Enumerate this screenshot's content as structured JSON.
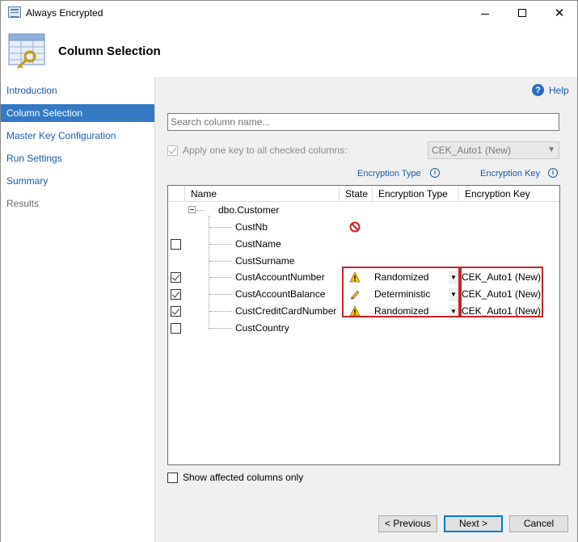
{
  "window": {
    "title": "Always Encrypted",
    "icon": "table-icon"
  },
  "header": {
    "title": "Column Selection",
    "icon": "table-key-icon"
  },
  "nav": {
    "items": [
      {
        "label": "Introduction",
        "state": "normal"
      },
      {
        "label": "Column Selection",
        "state": "active"
      },
      {
        "label": "Master Key Configuration",
        "state": "normal"
      },
      {
        "label": "Run Settings",
        "state": "normal"
      },
      {
        "label": "Summary",
        "state": "normal"
      },
      {
        "label": "Results",
        "state": "disabled"
      }
    ]
  },
  "help": {
    "label": "Help",
    "icon": "question-icon"
  },
  "search": {
    "placeholder": "Search column name..."
  },
  "apply": {
    "label": "Apply one key to all checked columns:",
    "checked": true,
    "key_value": "CEK_Auto1 (New)"
  },
  "column_headers": {
    "encryption_type_link": "Encryption Type",
    "encryption_key_link": "Encryption Key"
  },
  "grid": {
    "headers": [
      "Name",
      "State",
      "Encryption Type",
      "Encryption Key"
    ],
    "table_name": "dbo.Customer",
    "rows": [
      {
        "name": "CustNb",
        "checkbox": "none",
        "state_icon": "blocked-icon",
        "type": "",
        "key": ""
      },
      {
        "name": "CustName",
        "checkbox": "unchecked",
        "state_icon": "",
        "type": "",
        "key": ""
      },
      {
        "name": "CustSurname",
        "checkbox": "none",
        "state_icon": "",
        "type": "",
        "key": ""
      },
      {
        "name": "CustAccountNumber",
        "checkbox": "checked",
        "state_icon": "warning-icon",
        "type": "Randomized",
        "key": "CEK_Auto1 (New)"
      },
      {
        "name": "CustAccountBalance",
        "checkbox": "checked",
        "state_icon": "pencil-icon",
        "type": "Deterministic",
        "key": "CEK_Auto1 (New)"
      },
      {
        "name": "CustCreditCardNumber",
        "checkbox": "checked",
        "state_icon": "warning-icon",
        "type": "Randomized",
        "key": "CEK_Auto1 (New)"
      },
      {
        "name": "CustCountry",
        "checkbox": "unchecked",
        "state_icon": "",
        "type": "",
        "key": ""
      }
    ]
  },
  "show_affected": {
    "label": "Show affected columns only",
    "checked": false
  },
  "buttons": {
    "previous": "< Previous",
    "next": "Next >",
    "cancel": "Cancel"
  },
  "colors": {
    "accent": "#3379c4",
    "link": "#1c5aa8",
    "highlight_box": "#c9232a"
  }
}
